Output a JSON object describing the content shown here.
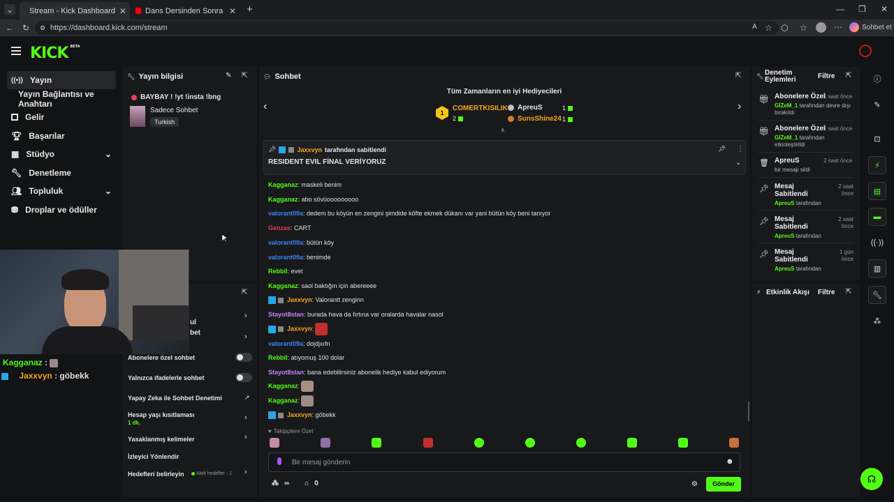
{
  "browser": {
    "tabs": [
      {
        "title": "Stream - Kick Dashboard",
        "active": true
      },
      {
        "title": "Dans Dersinden Sonra Ortadan Ka",
        "active": false
      }
    ],
    "url": "https://dashboard.kick.com/stream",
    "copilot_label": "Sohbet et"
  },
  "app": {
    "logo": "KICK",
    "logo_badge": "BETA",
    "accent": "#53fc18"
  },
  "sidebar": {
    "items": [
      {
        "label": "Yayın",
        "icon": "stream-icon",
        "active": true
      },
      {
        "label": "Yayın Bağlantısı ve Anahtarı",
        "icon": "",
        "active": false
      },
      {
        "label": "Gelir",
        "icon": "revenue-icon",
        "active": false
      },
      {
        "label": "Başarılar",
        "icon": "trophy-icon",
        "active": false
      },
      {
        "label": "Stüdyo",
        "icon": "studio-icon",
        "active": false,
        "expandable": true
      },
      {
        "label": "Denetleme",
        "icon": "wrench-icon",
        "active": false
      },
      {
        "label": "Topluluk",
        "icon": "community-icon",
        "active": false,
        "expandable": true
      },
      {
        "label": "Droplar ve ödüller",
        "icon": "drops-icon",
        "active": false
      }
    ]
  },
  "stream_info": {
    "header": "Yayın bilgisi",
    "title": "BAYBAY ! !yt !insta !bng",
    "category": "Sadece Sohbet",
    "language_tag": "Turkish"
  },
  "chat_settings": {
    "partial_1": "ul",
    "partial_2": "bet",
    "subscriber_only": "Abonelere özel sohbet",
    "emote_only": "Yalnızca ifadelerle sohbet",
    "ai_moderation": "Yapay Zeka ile Sohbet Denetimi",
    "account_age": "Hesap yaşı kısıtlaması",
    "account_age_value": "1 dk.",
    "banned_words": "Yasaklanmış kelimeler",
    "viewer_redirect": "İzleyici Yönlendir",
    "goals": "Hedefleri belirleyin",
    "goals_status": "Aktif hedefler - 1"
  },
  "webcam_overlay": {
    "lines": [
      {
        "user": "Kagganaz",
        "user_color": "#53fc18",
        "text": ":"
      },
      {
        "user": "Jaxxvyn",
        "user_color": "#f5a623",
        "text": ": göbekk"
      }
    ]
  },
  "chat": {
    "header": "Sohbet",
    "gifters_title": "Tüm Zamanların en iyi Hediyecileri",
    "gifters": [
      {
        "rank": "1",
        "name": "COMERTKISILIK",
        "count": "2",
        "color": "#f5a623"
      },
      {
        "name": "ApreuS",
        "count": "1",
        "color": "#e8e8e8"
      },
      {
        "name": "SunsShine24",
        "count": "1",
        "color": "#f5a623"
      }
    ],
    "pinned": {
      "by_user": "Jaxxvyn",
      "by_suffix": "tarafından sabitlendi",
      "text": "RESIDENT EVIL FİNAL VERİYORUZ"
    },
    "messages": [
      {
        "user": "Kagganaz",
        "color": "#53fc18",
        "text": ": maskeli benim"
      },
      {
        "user": "Kagganaz",
        "color": "#53fc18",
        "text": ": abo sövüooooooooo"
      },
      {
        "user": "valorant09a",
        "color": "#3b82f6",
        "text": ": dedem bu köyün en zengini şimdide köfte ekmek dükanı var yani bütün köy beni tanıyor"
      },
      {
        "user": "Genzas",
        "color": "#e53e5c",
        "text": ": CART"
      },
      {
        "user": "valorant09a",
        "color": "#3b82f6",
        "text": ": bütün köy"
      },
      {
        "user": "valorant09a",
        "color": "#3b82f6",
        "text": ": benimde"
      },
      {
        "user": "Rebbil",
        "color": "#53fc18",
        "text": ": evet"
      },
      {
        "user": "Kagganaz",
        "color": "#53fc18",
        "text": ": saol baktığın için abereeee"
      },
      {
        "user": "Jaxxvyn",
        "color": "#f5a623",
        "text": ": Valorantt zenginn",
        "badges": true
      },
      {
        "user": "Stayot8stan",
        "color": "#c084fc",
        "text": ": burada hava da fırtına var oralarda havalar nasol"
      },
      {
        "user": "Jaxxvyn",
        "color": "#f5a623",
        "text": ":",
        "badges": true,
        "emote": true
      },
      {
        "user": "valorant09a",
        "color": "#3b82f6",
        "text": ": dojdjxıfn"
      },
      {
        "user": "Rebbil",
        "color": "#53fc18",
        "text": ": atıyomuş 100 dolar"
      },
      {
        "user": "Stayot8stan",
        "color": "#c084fc",
        "text": ": bana edebilirsiniz abonelik hediye kabul ediyorum"
      },
      {
        "user": "Kagganaz",
        "color": "#53fc18",
        "text": ":",
        "emote": true
      },
      {
        "user": "Kagganaz",
        "color": "#53fc18",
        "text": ":",
        "emote": true
      },
      {
        "user": "Jaxxvyn",
        "color": "#f5a623",
        "text": ": göbekk",
        "badges": true
      }
    ],
    "followers_only": "Takipçilere Özel",
    "input_placeholder": "Bir mesaj gönderin",
    "points_value": "0",
    "send_label": "Gönder"
  },
  "moderation": {
    "header": "Denetim Eylemleri",
    "filter": "Filtre",
    "items": [
      {
        "title": "Abonelere Özel",
        "time": "1 saat önce",
        "user": "GİZeM_1",
        "desc": "tarafından devre dışı bırakıldı",
        "icon": "gift-icon"
      },
      {
        "title": "Abonelere Özel",
        "time": "1 saat önce",
        "user": "GİZeM_1",
        "desc": "tarafından etkinleştirildi",
        "icon": "gift-icon"
      },
      {
        "title": "ApreuS",
        "time": "2 saat önce",
        "user": "",
        "desc": "bir mesajı sildi",
        "icon": "trash-icon"
      },
      {
        "title": "Mesaj Sabitlendi",
        "time": "2 saat önce",
        "user": "ApreuS",
        "desc": "tarafından",
        "icon": "pin-icon"
      },
      {
        "title": "Mesaj Sabitlendi",
        "time": "2 saat önce",
        "user": "ApreuS",
        "desc": "tarafından",
        "icon": "pin-icon"
      },
      {
        "title": "Mesaj Sabitlendi",
        "time": "1 gün önce",
        "user": "ApreuS",
        "desc": "tarafından",
        "icon": "pin-icon"
      }
    ]
  },
  "activity": {
    "header": "Etkinlik Akışı",
    "filter": "Filtre"
  }
}
